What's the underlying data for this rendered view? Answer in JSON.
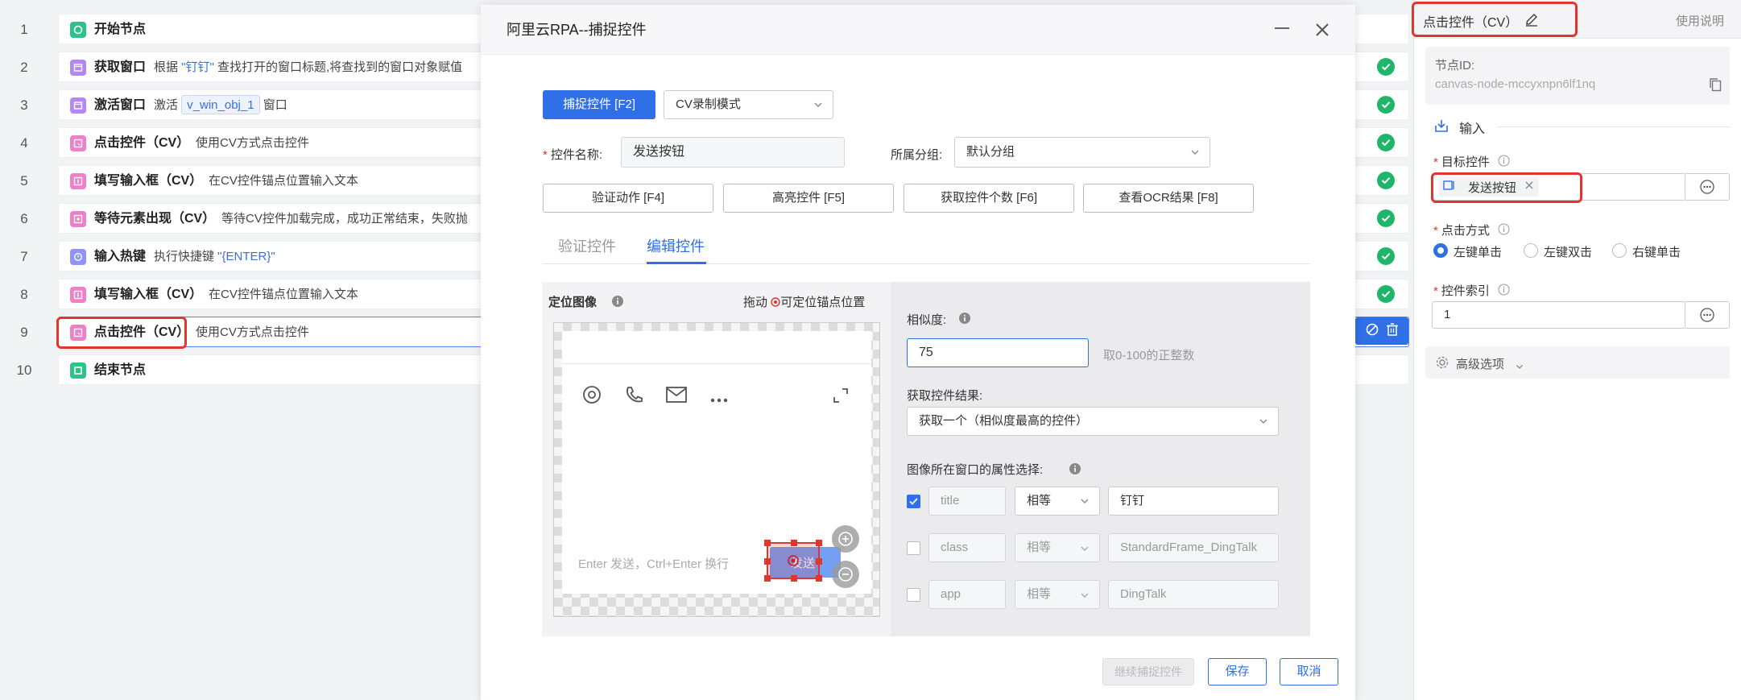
{
  "flow": {
    "rows": [
      {
        "num": "1",
        "name": "开始节点",
        "desc": ""
      },
      {
        "num": "2",
        "name": "获取窗口",
        "desc_a": "根据 ",
        "desc_q": "\"钉钉\"",
        "desc_b": " 查找打开的窗口标题,将查找到的窗口对象赋值"
      },
      {
        "num": "3",
        "name": "激活窗口",
        "desc_a": "激活 ",
        "chip": "v_win_obj_1",
        "desc_b": " 窗口"
      },
      {
        "num": "4",
        "name": "点击控件（CV）",
        "desc": "使用CV方式点击控件"
      },
      {
        "num": "5",
        "name": "填写输入框（CV）",
        "desc": "在CV控件锚点位置输入文本"
      },
      {
        "num": "6",
        "name": "等待元素出现（CV）",
        "desc": "等待CV控件加载完成，成功正常结束，失败抛"
      },
      {
        "num": "7",
        "name": "输入热键",
        "desc_a": "执行快捷键 ",
        "desc_q": "\"{ENTER}\""
      },
      {
        "num": "8",
        "name": "填写输入框（CV）",
        "desc": "在CV控件锚点位置输入文本"
      },
      {
        "num": "9",
        "name": "点击控件（CV）",
        "desc": "使用CV方式点击控件"
      },
      {
        "num": "10",
        "name": "结束节点",
        "desc": ""
      }
    ]
  },
  "modal": {
    "title": "阿里云RPA--捕捉控件",
    "capture_btn": "捕捉控件 [F2]",
    "mode_select": "CV录制模式",
    "name_label": "控件名称:",
    "name_value": "发送按钮",
    "group_label": "所属分组:",
    "group_value": "默认分组",
    "action_buttons": [
      "验证动作 [F4]",
      "高亮控件 [F5]",
      "获取控件个数 [F6]",
      "查看OCR结果 [F8]"
    ],
    "tabs": [
      "验证控件",
      "编辑控件"
    ],
    "locate_image_label": "定位图像",
    "drag_hint_a": "拖动",
    "drag_hint_b": "可定位锚点位置",
    "preview_input_placeholder": "Enter 发送，Ctrl+Enter 换行",
    "preview_send_label": "发送",
    "similarity_label": "相似度:",
    "similarity_value": "75",
    "similarity_hint": "取0-100的正整数",
    "result_label": "获取控件结果:",
    "result_value": "获取一个（相似度最高的控件）",
    "attr_label": "图像所在窗口的属性选择:",
    "attrs": [
      {
        "checked": true,
        "name": "title",
        "op": "相等",
        "value": "钉钉"
      },
      {
        "checked": false,
        "name": "class",
        "op": "相等",
        "value": "StandardFrame_DingTalk"
      },
      {
        "checked": false,
        "name": "app",
        "op": "相等",
        "value": "DingTalk"
      }
    ],
    "continue_btn": "继续捕捉控件",
    "save_btn": "保存",
    "cancel_btn": "取消"
  },
  "props": {
    "title": "点击控件（CV）",
    "help": "使用说明",
    "node_id_label": "节点ID:",
    "node_id_value": "canvas-node-mccyxnpn6lf1nq",
    "input_section": "输入",
    "target_label": "目标控件",
    "target_value": "发送按钮",
    "click_label": "点击方式",
    "click_options": [
      "左键单击",
      "左键双击",
      "右键单击"
    ],
    "index_label": "控件索引",
    "index_value": "1",
    "advanced": "高级选项"
  },
  "colors": {
    "accent": "#2f6fe8",
    "highlight": "#e0362c",
    "success": "#1fb66a"
  }
}
